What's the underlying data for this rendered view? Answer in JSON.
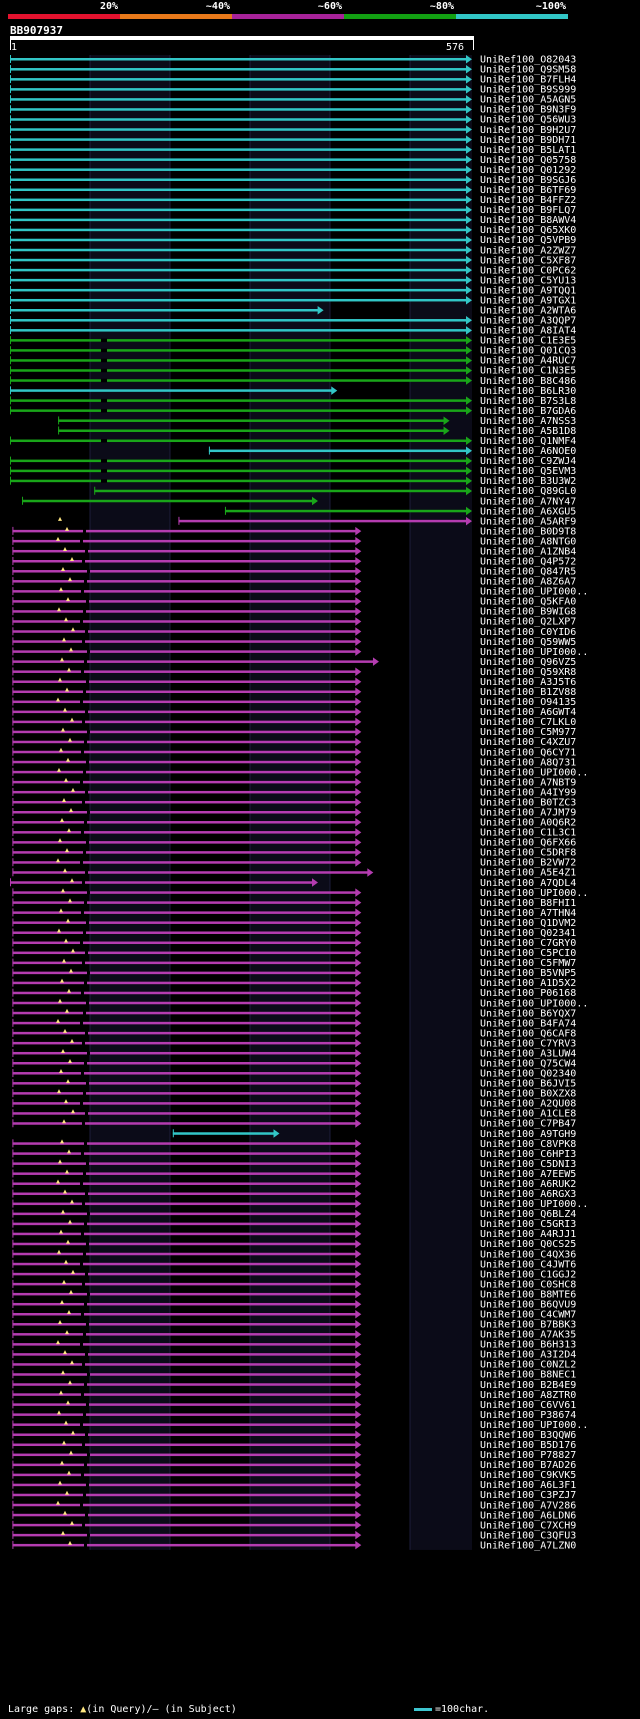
{
  "legend": {
    "segments": [
      {
        "label": "20%",
        "color": "#e3122e"
      },
      {
        "label": "~40%",
        "color": "#e8791a"
      },
      {
        "label": "~60%",
        "color": "#a8239a"
      },
      {
        "label": "~80%",
        "color": "#12a012"
      },
      {
        "label": "~100%",
        "color": "#32c6c6"
      }
    ]
  },
  "query": {
    "id": "BB907937",
    "start_label": "1",
    "end_label": "576",
    "length": 576
  },
  "colors": {
    "cyan": "#32c6c6",
    "green": "#19a519",
    "magenta": "#b43cb0",
    "gap": "#ffe680"
  },
  "hits": [
    {
      "name": "UniRef100_O82043",
      "s": 0,
      "e": 576,
      "c": "cyan"
    },
    {
      "name": "UniRef100_Q9SM58",
      "s": 0,
      "e": 576,
      "c": "cyan"
    },
    {
      "name": "UniRef100_B7FLH4",
      "s": 0,
      "e": 576,
      "c": "cyan"
    },
    {
      "name": "UniRef100_B9S999",
      "s": 0,
      "e": 576,
      "c": "cyan"
    },
    {
      "name": "UniRef100_A5AGN5",
      "s": 0,
      "e": 576,
      "c": "cyan"
    },
    {
      "name": "UniRef100_B9N3F9",
      "s": 0,
      "e": 576,
      "c": "cyan"
    },
    {
      "name": "UniRef100_Q56WU3",
      "s": 0,
      "e": 576,
      "c": "cyan"
    },
    {
      "name": "UniRef100_B9H2U7",
      "s": 0,
      "e": 576,
      "c": "cyan"
    },
    {
      "name": "UniRef100_B9DH71",
      "s": 0,
      "e": 576,
      "c": "cyan"
    },
    {
      "name": "UniRef100_B5LAT1",
      "s": 0,
      "e": 576,
      "c": "cyan"
    },
    {
      "name": "UniRef100_Q05758",
      "s": 0,
      "e": 576,
      "c": "cyan"
    },
    {
      "name": "UniRef100_Q01292",
      "s": 0,
      "e": 576,
      "c": "cyan"
    },
    {
      "name": "UniRef100_B9SGJ6",
      "s": 0,
      "e": 576,
      "c": "cyan"
    },
    {
      "name": "UniRef100_B6TF69",
      "s": 0,
      "e": 576,
      "c": "cyan"
    },
    {
      "name": "UniRef100_B4FFZ2",
      "s": 0,
      "e": 576,
      "c": "cyan"
    },
    {
      "name": "UniRef100_B9FLQ7",
      "s": 0,
      "e": 576,
      "c": "cyan"
    },
    {
      "name": "UniRef100_B8AWV4",
      "s": 0,
      "e": 576,
      "c": "cyan"
    },
    {
      "name": "UniRef100_Q65XK0",
      "s": 0,
      "e": 576,
      "c": "cyan"
    },
    {
      "name": "UniRef100_Q5VPB9",
      "s": 0,
      "e": 576,
      "c": "cyan"
    },
    {
      "name": "UniRef100_A2ZWZ7",
      "s": 0,
      "e": 576,
      "c": "cyan"
    },
    {
      "name": "UniRef100_C5XF87",
      "s": 0,
      "e": 576,
      "c": "cyan"
    },
    {
      "name": "UniRef100_C0PC62",
      "s": 0,
      "e": 576,
      "c": "cyan"
    },
    {
      "name": "UniRef100_C5YU13",
      "s": 0,
      "e": 576,
      "c": "cyan"
    },
    {
      "name": "UniRef100_A9TQQ1",
      "s": 0,
      "e": 576,
      "c": "cyan"
    },
    {
      "name": "UniRef100_A9TGX1",
      "s": 0,
      "e": 576,
      "c": "cyan"
    },
    {
      "name": "UniRef100_A2WTA6",
      "s": 0,
      "e": 391,
      "c": "cyan"
    },
    {
      "name": "UniRef100_A3QQP7",
      "s": 0,
      "e": 576,
      "c": "cyan"
    },
    {
      "name": "UniRef100_A8IAT4",
      "s": 0,
      "e": 576,
      "c": "cyan"
    },
    {
      "name": "UniRef100_C1E3E5",
      "s": 0,
      "e": 576,
      "c": "green"
    },
    {
      "name": "UniRef100_Q01CQ3",
      "s": 0,
      "e": 576,
      "c": "green"
    },
    {
      "name": "UniRef100_A4RUC7",
      "s": 0,
      "e": 576,
      "c": "green"
    },
    {
      "name": "UniRef100_C1N3E5",
      "s": 0,
      "e": 576,
      "c": "green"
    },
    {
      "name": "UniRef100_B8C486",
      "s": 0,
      "e": 576,
      "c": "green"
    },
    {
      "name": "UniRef100_B6LR30",
      "s": 0,
      "e": 408,
      "c": "cyan"
    },
    {
      "name": "UniRef100_B7S3L8",
      "s": 0,
      "e": 576,
      "c": "green"
    },
    {
      "name": "UniRef100_B7GDA6",
      "s": 0,
      "e": 576,
      "c": "green"
    },
    {
      "name": "UniRef100_A7NSS3",
      "s": 60,
      "e": 548,
      "c": "green"
    },
    {
      "name": "UniRef100_A5B1D8",
      "s": 60,
      "e": 548,
      "c": "green"
    },
    {
      "name": "UniRef100_Q1NMF4",
      "s": 0,
      "e": 576,
      "c": "green"
    },
    {
      "name": "UniRef100_A6NOE0",
      "s": 248,
      "e": 576,
      "c": "cyan"
    },
    {
      "name": "UniRef100_C9ZWJ4",
      "s": 0,
      "e": 576,
      "c": "green"
    },
    {
      "name": "UniRef100_Q5EVM3",
      "s": 0,
      "e": 576,
      "c": "green"
    },
    {
      "name": "UniRef100_B3U3W2",
      "s": 0,
      "e": 576,
      "c": "green"
    },
    {
      "name": "UniRef100_Q89GL0",
      "s": 105,
      "e": 576,
      "c": "green"
    },
    {
      "name": "UniRef100_A7NY47",
      "s": 15,
      "e": 384,
      "c": "green"
    },
    {
      "name": "UniRef100_A6XGU5",
      "s": 268,
      "e": 576,
      "c": "green"
    },
    {
      "name": "UniRef100_A5ARF9",
      "s": 210,
      "e": 576,
      "c": "magenta"
    },
    {
      "name": "UniRef100_B0D9T8",
      "s": 3,
      "e": 438,
      "c": "magenta"
    },
    {
      "name": "UniRef100_A8NTG0",
      "s": 3,
      "e": 438,
      "c": "magenta"
    },
    {
      "name": "UniRef100_A1ZNB4",
      "s": 3,
      "e": 438,
      "c": "magenta"
    },
    {
      "name": "UniRef100_Q4P572",
      "s": 3,
      "e": 438,
      "c": "magenta"
    },
    {
      "name": "UniRef100_Q847R5",
      "s": 3,
      "e": 438,
      "c": "magenta"
    },
    {
      "name": "UniRef100_A8Z6A7",
      "s": 3,
      "e": 438,
      "c": "magenta"
    },
    {
      "name": "UniRef100_UPI000..",
      "s": 3,
      "e": 438,
      "c": "magenta"
    },
    {
      "name": "UniRef100_Q5KFA0",
      "s": 3,
      "e": 438,
      "c": "magenta"
    },
    {
      "name": "UniRef100_B9WIG8",
      "s": 3,
      "e": 438,
      "c": "magenta"
    },
    {
      "name": "UniRef100_Q2LXP7",
      "s": 3,
      "e": 438,
      "c": "magenta"
    },
    {
      "name": "UniRef100_C0YID6",
      "s": 3,
      "e": 438,
      "c": "magenta"
    },
    {
      "name": "UniRef100_Q59WW5",
      "s": 3,
      "e": 438,
      "c": "magenta"
    },
    {
      "name": "UniRef100_UPI000..",
      "s": 3,
      "e": 438,
      "c": "magenta"
    },
    {
      "name": "UniRef100_Q96VZ5",
      "s": 3,
      "e": 460,
      "c": "magenta"
    },
    {
      "name": "UniRef100_Q59XR8",
      "s": 3,
      "e": 438,
      "c": "magenta"
    },
    {
      "name": "UniRef100_A3J5T6",
      "s": 3,
      "e": 438,
      "c": "magenta"
    },
    {
      "name": "UniRef100_B1ZV88",
      "s": 3,
      "e": 438,
      "c": "magenta"
    },
    {
      "name": "UniRef100_O94135",
      "s": 3,
      "e": 438,
      "c": "magenta"
    },
    {
      "name": "UniRef100_A6GWT4",
      "s": 3,
      "e": 438,
      "c": "magenta"
    },
    {
      "name": "UniRef100_C7LKL0",
      "s": 3,
      "e": 438,
      "c": "magenta"
    },
    {
      "name": "UniRef100_C5M977",
      "s": 3,
      "e": 438,
      "c": "magenta"
    },
    {
      "name": "UniRef100_C4XZU7",
      "s": 3,
      "e": 438,
      "c": "magenta"
    },
    {
      "name": "UniRef100_Q6CY71",
      "s": 3,
      "e": 438,
      "c": "magenta"
    },
    {
      "name": "UniRef100_A8Q731",
      "s": 3,
      "e": 438,
      "c": "magenta"
    },
    {
      "name": "UniRef100_UPI000..",
      "s": 3,
      "e": 438,
      "c": "magenta"
    },
    {
      "name": "UniRef100_A7NBT9",
      "s": 3,
      "e": 438,
      "c": "magenta"
    },
    {
      "name": "UniRef100_A4IY99",
      "s": 3,
      "e": 438,
      "c": "magenta"
    },
    {
      "name": "UniRef100_B0TZC3",
      "s": 3,
      "e": 438,
      "c": "magenta"
    },
    {
      "name": "UniRef100_A7JM79",
      "s": 3,
      "e": 438,
      "c": "magenta"
    },
    {
      "name": "UniRef100_A0Q6R2",
      "s": 3,
      "e": 438,
      "c": "magenta"
    },
    {
      "name": "UniRef100_C1L3C1",
      "s": 3,
      "e": 438,
      "c": "magenta"
    },
    {
      "name": "UniRef100_Q6FX66",
      "s": 3,
      "e": 438,
      "c": "magenta"
    },
    {
      "name": "UniRef100_C5DRF8",
      "s": 3,
      "e": 438,
      "c": "magenta"
    },
    {
      "name": "UniRef100_B2VW72",
      "s": 3,
      "e": 438,
      "c": "magenta"
    },
    {
      "name": "UniRef100_A5E4Z1",
      "s": 3,
      "e": 453,
      "c": "magenta"
    },
    {
      "name": "UniRef100_A7QDL4",
      "s": 0,
      "e": 384,
      "c": "magenta"
    },
    {
      "name": "UniRef100_UPI000..",
      "s": 3,
      "e": 438,
      "c": "magenta"
    },
    {
      "name": "UniRef100_B8FHI1",
      "s": 3,
      "e": 438,
      "c": "magenta"
    },
    {
      "name": "UniRef100_A7THN4",
      "s": 3,
      "e": 438,
      "c": "magenta"
    },
    {
      "name": "UniRef100_Q1DVM2",
      "s": 3,
      "e": 438,
      "c": "magenta"
    },
    {
      "name": "UniRef100_Q02341",
      "s": 3,
      "e": 438,
      "c": "magenta"
    },
    {
      "name": "UniRef100_C7GRY0",
      "s": 3,
      "e": 438,
      "c": "magenta"
    },
    {
      "name": "UniRef100_C5PCI0",
      "s": 3,
      "e": 438,
      "c": "magenta"
    },
    {
      "name": "UniRef100_C5FMW7",
      "s": 3,
      "e": 438,
      "c": "magenta"
    },
    {
      "name": "UniRef100_B5VNP5",
      "s": 3,
      "e": 438,
      "c": "magenta"
    },
    {
      "name": "UniRef100_A1D5X2",
      "s": 3,
      "e": 438,
      "c": "magenta"
    },
    {
      "name": "UniRef100_P06168",
      "s": 3,
      "e": 438,
      "c": "magenta"
    },
    {
      "name": "UniRef100_UPI000..",
      "s": 3,
      "e": 438,
      "c": "magenta"
    },
    {
      "name": "UniRef100_B6YQX7",
      "s": 3,
      "e": 438,
      "c": "magenta"
    },
    {
      "name": "UniRef100_B4FA74",
      "s": 3,
      "e": 438,
      "c": "magenta"
    },
    {
      "name": "UniRef100_Q6CAF8",
      "s": 3,
      "e": 438,
      "c": "magenta"
    },
    {
      "name": "UniRef100_C7YRV3",
      "s": 3,
      "e": 438,
      "c": "magenta"
    },
    {
      "name": "UniRef100_A3LUW4",
      "s": 3,
      "e": 438,
      "c": "magenta"
    },
    {
      "name": "UniRef100_Q75CW4",
      "s": 3,
      "e": 438,
      "c": "magenta"
    },
    {
      "name": "UniRef100_Q02340",
      "s": 3,
      "e": 438,
      "c": "magenta"
    },
    {
      "name": "UniRef100_B6JVI5",
      "s": 3,
      "e": 438,
      "c": "magenta"
    },
    {
      "name": "UniRef100_B0XZX8",
      "s": 3,
      "e": 438,
      "c": "magenta"
    },
    {
      "name": "UniRef100_A2QU08",
      "s": 3,
      "e": 438,
      "c": "magenta"
    },
    {
      "name": "UniRef100_A1CLE8",
      "s": 3,
      "e": 438,
      "c": "magenta"
    },
    {
      "name": "UniRef100_C7PB47",
      "s": 3,
      "e": 438,
      "c": "magenta"
    },
    {
      "name": "UniRef100_A9TGH9",
      "s": 203,
      "e": 336,
      "c": "cyan"
    },
    {
      "name": "UniRef100_C8VPK8",
      "s": 3,
      "e": 438,
      "c": "magenta"
    },
    {
      "name": "UniRef100_C6HPI3",
      "s": 3,
      "e": 438,
      "c": "magenta"
    },
    {
      "name": "UniRef100_C5DNI3",
      "s": 3,
      "e": 438,
      "c": "magenta"
    },
    {
      "name": "UniRef100_A7EEW5",
      "s": 3,
      "e": 438,
      "c": "magenta"
    },
    {
      "name": "UniRef100_A6RUK2",
      "s": 3,
      "e": 438,
      "c": "magenta"
    },
    {
      "name": "UniRef100_A6RGX3",
      "s": 3,
      "e": 438,
      "c": "magenta"
    },
    {
      "name": "UniRef100_UPI000..",
      "s": 3,
      "e": 438,
      "c": "magenta"
    },
    {
      "name": "UniRef100_Q6BLZ4",
      "s": 3,
      "e": 438,
      "c": "magenta"
    },
    {
      "name": "UniRef100_C5GRI3",
      "s": 3,
      "e": 438,
      "c": "magenta"
    },
    {
      "name": "UniRef100_A4RJJ1",
      "s": 3,
      "e": 438,
      "c": "magenta"
    },
    {
      "name": "UniRef100_Q0CS25",
      "s": 3,
      "e": 438,
      "c": "magenta"
    },
    {
      "name": "UniRef100_C4QX36",
      "s": 3,
      "e": 438,
      "c": "magenta"
    },
    {
      "name": "UniRef100_C4JWT6",
      "s": 3,
      "e": 438,
      "c": "magenta"
    },
    {
      "name": "UniRef100_C1GGJ2",
      "s": 3,
      "e": 438,
      "c": "magenta"
    },
    {
      "name": "UniRef100_C0SHC8",
      "s": 3,
      "e": 438,
      "c": "magenta"
    },
    {
      "name": "UniRef100_B8MTE6",
      "s": 3,
      "e": 438,
      "c": "magenta"
    },
    {
      "name": "UniRef100_B6QVU9",
      "s": 3,
      "e": 438,
      "c": "magenta"
    },
    {
      "name": "UniRef100_C4CWM7",
      "s": 3,
      "e": 438,
      "c": "magenta"
    },
    {
      "name": "UniRef100_B7BBK3",
      "s": 3,
      "e": 438,
      "c": "magenta"
    },
    {
      "name": "UniRef100_A7AK35",
      "s": 3,
      "e": 438,
      "c": "magenta"
    },
    {
      "name": "UniRef100_B6H313",
      "s": 3,
      "e": 438,
      "c": "magenta"
    },
    {
      "name": "UniRef100_A3I2D4",
      "s": 3,
      "e": 438,
      "c": "magenta"
    },
    {
      "name": "UniRef100_C0NZL2",
      "s": 3,
      "e": 438,
      "c": "magenta"
    },
    {
      "name": "UniRef100_B8NEC1",
      "s": 3,
      "e": 438,
      "c": "magenta"
    },
    {
      "name": "UniRef100_B2B4E9",
      "s": 3,
      "e": 438,
      "c": "magenta"
    },
    {
      "name": "UniRef100_A8ZTR0",
      "s": 3,
      "e": 438,
      "c": "magenta"
    },
    {
      "name": "UniRef100_C6VV61",
      "s": 3,
      "e": 438,
      "c": "magenta"
    },
    {
      "name": "UniRef100_P38674",
      "s": 3,
      "e": 438,
      "c": "magenta"
    },
    {
      "name": "UniRef100_UPI000..",
      "s": 3,
      "e": 438,
      "c": "magenta"
    },
    {
      "name": "UniRef100_B3QQW6",
      "s": 3,
      "e": 438,
      "c": "magenta"
    },
    {
      "name": "UniRef100_B5D176",
      "s": 3,
      "e": 438,
      "c": "magenta"
    },
    {
      "name": "UniRef100_P78827",
      "s": 3,
      "e": 438,
      "c": "magenta"
    },
    {
      "name": "UniRef100_B7AD26",
      "s": 3,
      "e": 438,
      "c": "magenta"
    },
    {
      "name": "UniRef100_C9KVK5",
      "s": 3,
      "e": 438,
      "c": "magenta"
    },
    {
      "name": "UniRef100_A6L3F1",
      "s": 3,
      "e": 438,
      "c": "magenta"
    },
    {
      "name": "UniRef100_C3PZJ7",
      "s": 3,
      "e": 438,
      "c": "magenta"
    },
    {
      "name": "UniRef100_A7V286",
      "s": 3,
      "e": 438,
      "c": "magenta"
    },
    {
      "name": "UniRef100_A6LDN6",
      "s": 3,
      "e": 438,
      "c": "magenta"
    },
    {
      "name": "UniRef100_C7XCH9",
      "s": 3,
      "e": 438,
      "c": "magenta"
    },
    {
      "name": "UniRef100_C3QFU3",
      "s": 3,
      "e": 438,
      "c": "magenta"
    },
    {
      "name": "UniRef100_A7LZN0",
      "s": 3,
      "e": 438,
      "c": "magenta"
    }
  ],
  "footer": {
    "gaps_text": "Large gaps: ",
    "gaps_query": "▲",
    "gaps_query_text": "(in Query)/",
    "gaps_subject_text": "— (in Subject)",
    "scale_text": "=100char."
  }
}
